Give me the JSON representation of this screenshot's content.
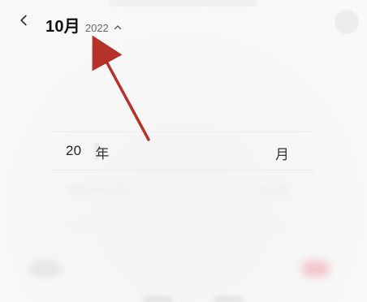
{
  "header": {
    "month_title": "10月",
    "year_label": "2022"
  },
  "picker": {
    "selected_year_prefix": "20",
    "selected_year_unit": "年",
    "selected_month_unit": "月"
  },
  "colors": {
    "background": "#f7f7f7",
    "title_text": "#111111",
    "secondary_text": "#666666",
    "annotation_arrow": "#b5322b",
    "bottom_right_accent": "#f3c6cb"
  },
  "icons": {
    "back": "chevron-left-icon",
    "year_toggle": "chevron-up-icon",
    "annotation": "arrow-icon"
  }
}
